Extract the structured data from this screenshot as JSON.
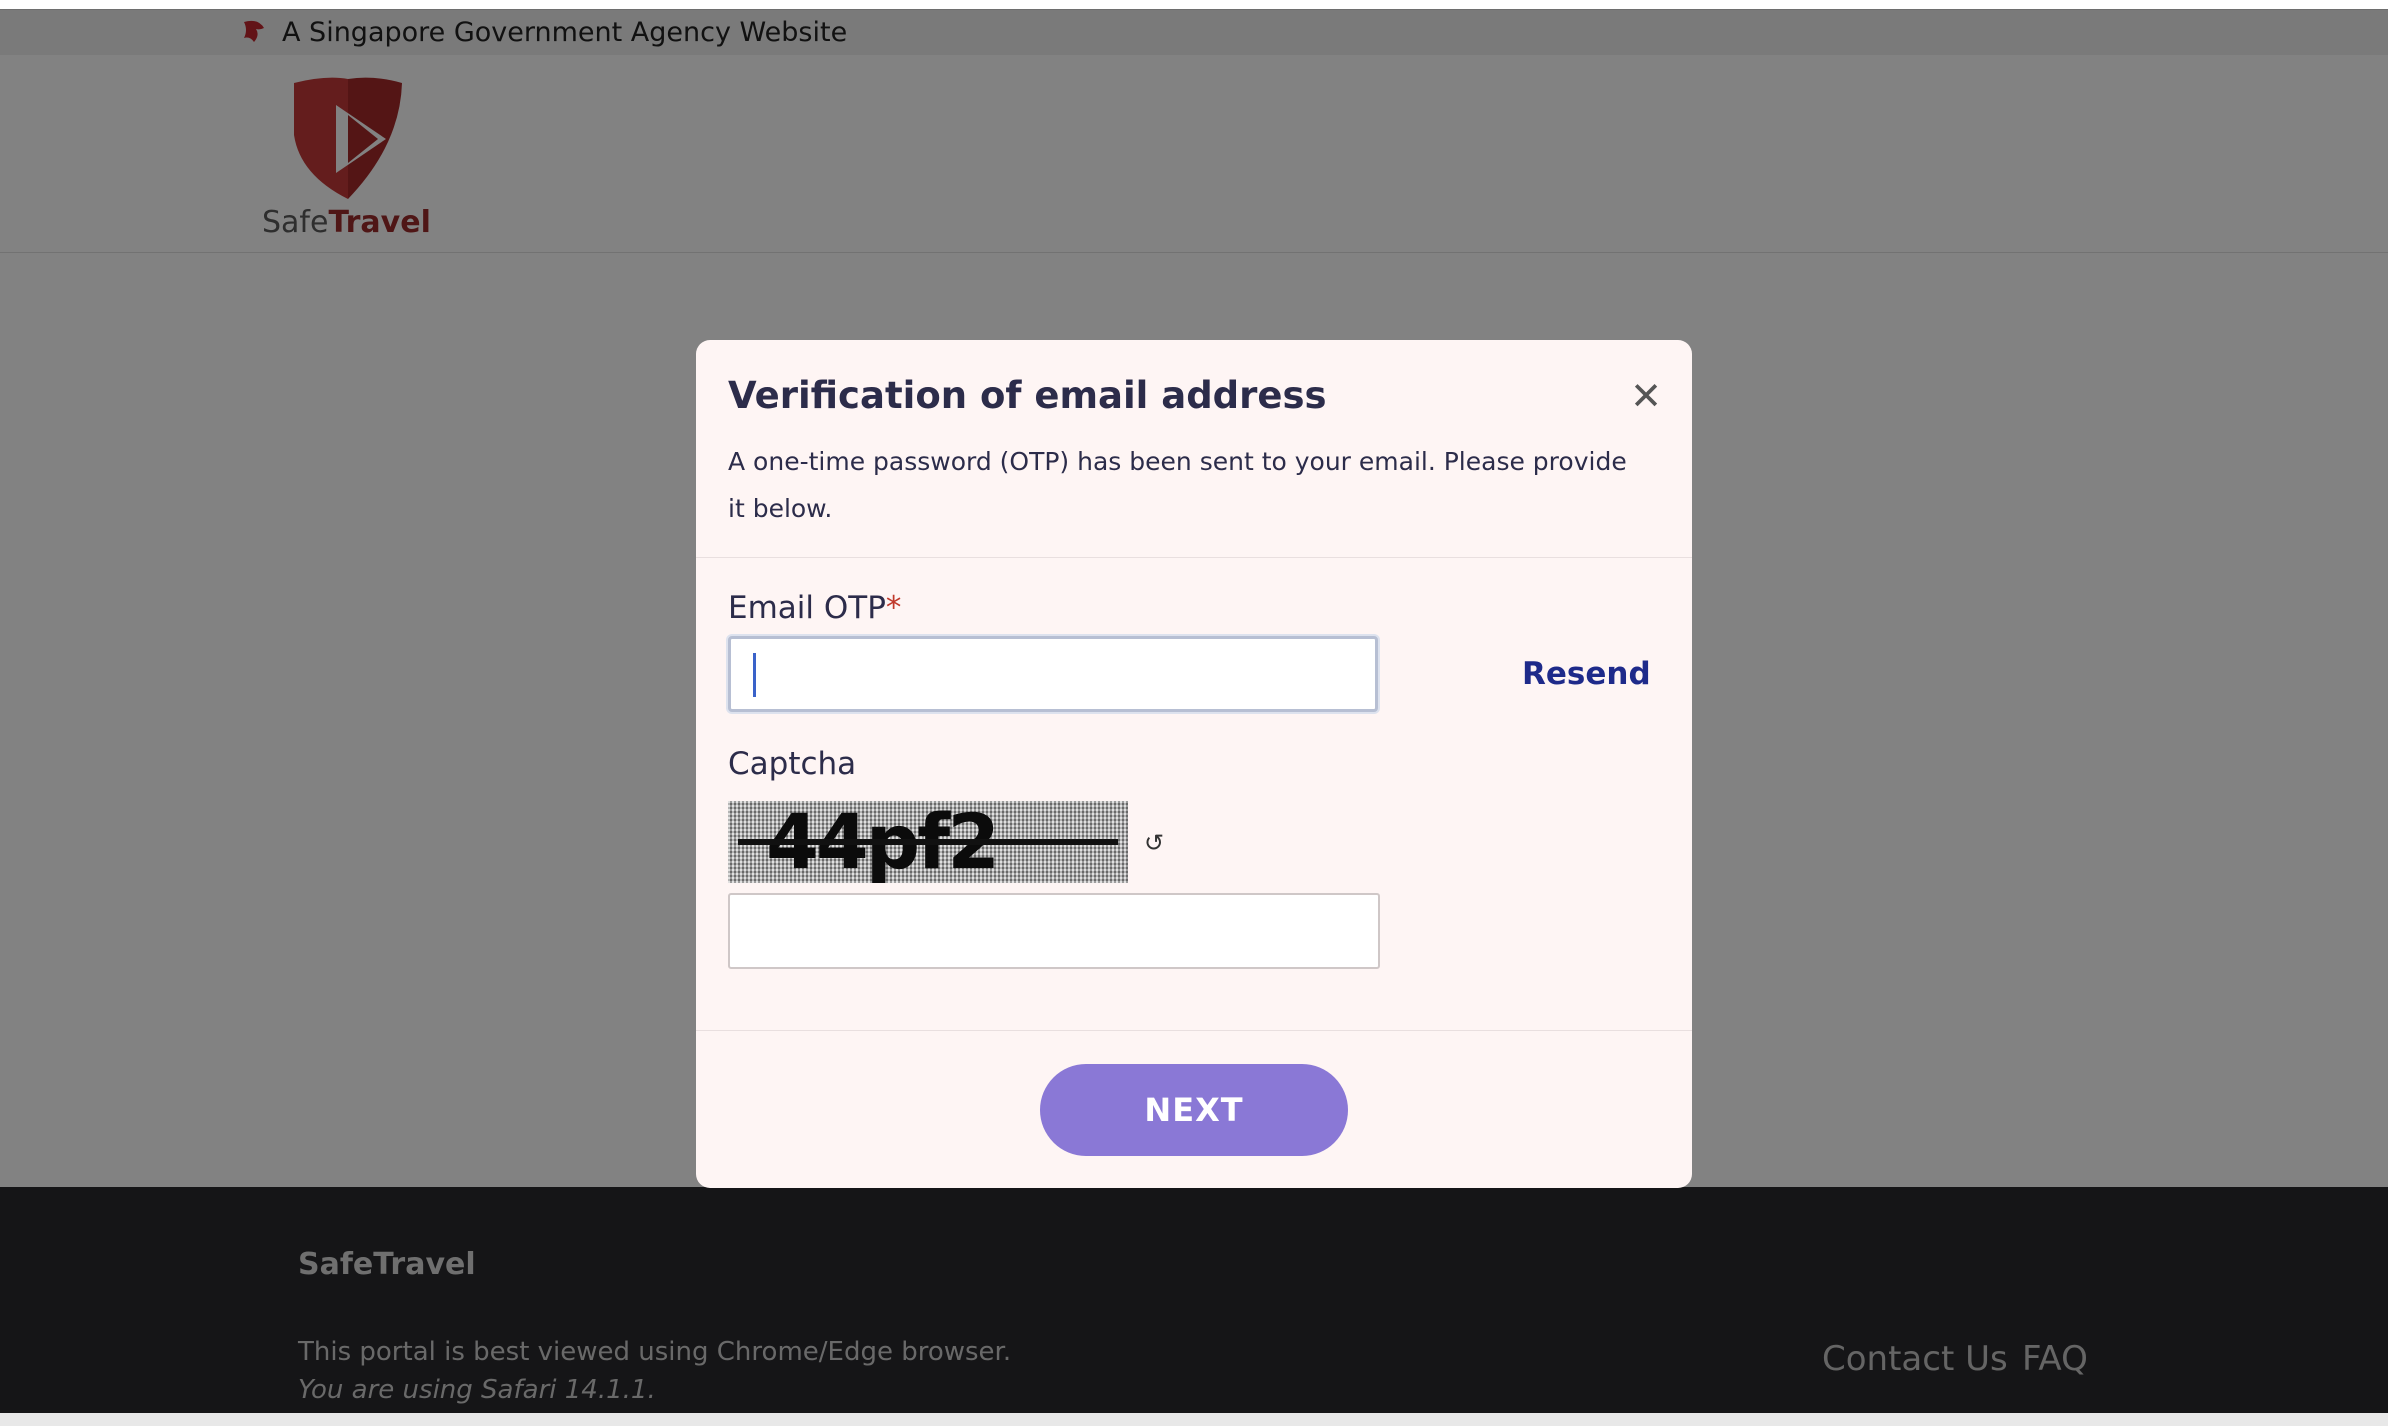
{
  "gov_banner": {
    "text": "A Singapore Government Agency Website"
  },
  "header": {
    "logo_prefix": "Safe",
    "logo_suffix": "Travel"
  },
  "modal": {
    "title": "Verification of email address",
    "close_symbol": "✕",
    "description": "A one-time password (OTP) has been sent to your email. Please provide it below.",
    "otp": {
      "label": "Email OTP",
      "required_mark": "*",
      "value": "",
      "resend_label": "Resend"
    },
    "captcha": {
      "label": "Captcha",
      "image_text": "44pf2",
      "refresh_symbol": "↺",
      "value": ""
    },
    "next_label": "NEXT"
  },
  "footer": {
    "title": "SafeTravel",
    "browser_note": "This portal is best viewed using Chrome/Edge browser.",
    "browser_detected": "You are using Safari 14.1.1.",
    "links": [
      "Contact Us",
      "FAQ"
    ]
  },
  "colors": {
    "accent_button": "#8a78d6",
    "link": "#1e2a8a",
    "brand_red": "#9b2b2b",
    "footer_bg": "#2a2a2e"
  }
}
